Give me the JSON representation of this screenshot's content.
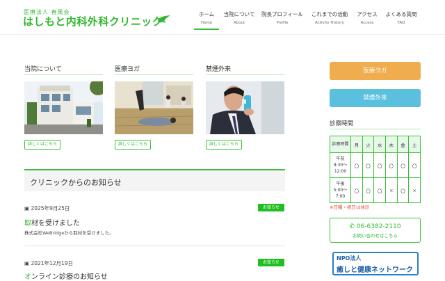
{
  "header": {
    "logo_sub": "医療法人 春風会",
    "logo_main": "はしもと内科外科クリニック",
    "nav": [
      {
        "jp": "ホーム",
        "en": "Home"
      },
      {
        "jp": "当院について",
        "en": "About"
      },
      {
        "jp": "院長プロフィール",
        "en": "Profile"
      },
      {
        "jp": "これまでの活動",
        "en": "Activity History"
      },
      {
        "jp": "アクセス",
        "en": "Access"
      },
      {
        "jp": "よくある質問",
        "en": "FAQ"
      }
    ]
  },
  "features": [
    {
      "title": "当院について",
      "button": "詳しくはこちら",
      "image": "clinic-building"
    },
    {
      "title": "医療ヨガ",
      "button": "詳しくはこちら",
      "image": "yoga-class"
    },
    {
      "title": "禁煙外来",
      "button": "詳しくはこちら",
      "image": "man-with-inhaler"
    }
  ],
  "news": {
    "heading": "クリニックからのお知らせ",
    "items": [
      {
        "date": "2025年9月25日",
        "badge": "お知らせ",
        "title_first": "取",
        "title_rest": "材を受けました",
        "body": "株式会社WeBridgeから取材を受けました。"
      },
      {
        "date": "2021年12月19日",
        "badge": "お知らせ",
        "title_first": "オ",
        "title_rest": "ンライン診療のお知らせ",
        "body": ""
      }
    ]
  },
  "sidebar": {
    "yoga_button": "医療ヨガ",
    "smoking_button": "禁煙外来",
    "hours_title": "診察時間",
    "table_header": [
      "診察時間",
      "月",
      "火",
      "水",
      "木",
      "金",
      "土"
    ],
    "rows": [
      {
        "label": "午前 9:30〜 12:00",
        "cells": [
          "〇",
          "〇",
          "〇",
          "〇",
          "〇",
          "〇"
        ]
      },
      {
        "label": "午後 5:00〜 7:00",
        "cells": [
          "〇",
          "〇",
          "〇",
          "×",
          "〇",
          "×"
        ]
      }
    ],
    "note": "※日曜・祝日は休診",
    "phone": "06-6382-2110",
    "phone_sub": "お問い合わせはこちら",
    "npo_line1": "NPO法人",
    "npo_line2": "癒しと健康ネットワーク"
  },
  "colors": {
    "green": "#3cbf3c",
    "orange": "#f0ad4e",
    "blue": "#5bc0de",
    "red": "#e0443a",
    "npo_blue": "#1a5fa8"
  }
}
